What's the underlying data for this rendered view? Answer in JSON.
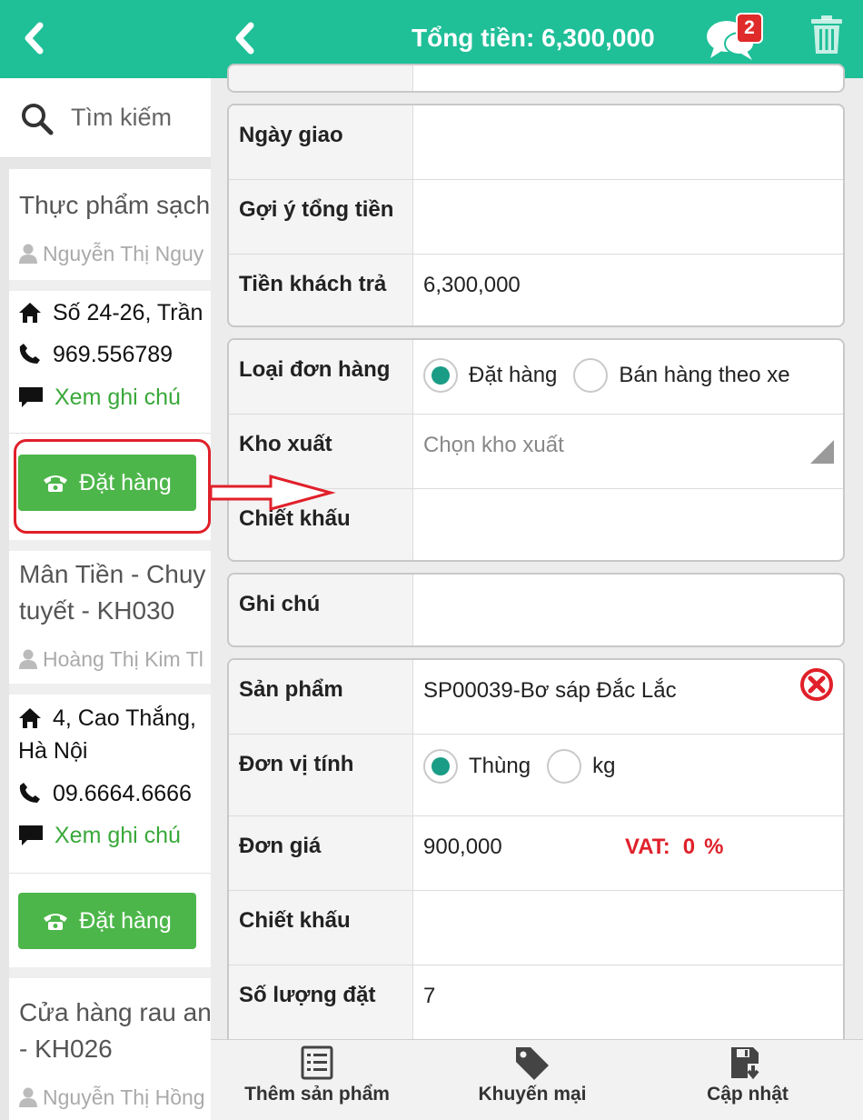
{
  "header": {
    "total_label": "Tổng tiền: 6,300,000",
    "chat_badge": "2"
  },
  "search": {
    "placeholder": "Tìm kiếm"
  },
  "customers": [
    {
      "name": "Thực phẩm sạch",
      "staff": "Nguyễn Thị Nguy",
      "address": "Số 24-26, Trần",
      "phone": "969.556789",
      "note_link": "Xem ghi chú",
      "order_button": "Đặt hàng"
    },
    {
      "name_line1": "Mân Tiền - Chuy",
      "name_line2": "tuyết - KH030",
      "staff": "Hoàng Thị Kim Tl",
      "address_line1": "4, Cao Thắng,",
      "address_line2": "Hà Nội",
      "phone": "09.6664.6666",
      "note_link": "Xem ghi chú",
      "order_button": "Đặt hàng"
    },
    {
      "name_line1": "Cửa hàng rau an",
      "name_line2": "- KH026",
      "staff": "Nguyễn Thị Hồng"
    }
  ],
  "order_form": {
    "delivery_date_label": "Ngày giao",
    "delivery_date_value": "",
    "suggested_total_label": "Gợi ý tổng tiền",
    "suggested_total_value": "",
    "customer_paid_label": "Tiền khách trả",
    "customer_paid_value": "6,300,000",
    "order_type_label": "Loại đơn hàng",
    "order_type_options": [
      "Đặt hàng",
      "Bán hàng theo xe"
    ],
    "order_type_selected": "Đặt hàng",
    "warehouse_label": "Kho xuất",
    "warehouse_placeholder": "Chọn kho xuất",
    "discount_label": "Chiết khấu",
    "discount_value": "",
    "note_label": "Ghi chú",
    "note_value": ""
  },
  "product": {
    "product_label": "Sản phẩm",
    "product_value": "SP00039-Bơ sáp Đắc Lắc",
    "unit_label": "Đơn vị tính",
    "unit_options": [
      "Thùng",
      "kg"
    ],
    "unit_selected": "Thùng",
    "price_label": "Đơn giá",
    "price_value": "900,000",
    "vat_label": "VAT:",
    "vat_value": "0",
    "vat_unit": "%",
    "discount_label": "Chiết khấu",
    "discount_value": "",
    "quantity_label": "Số lượng đặt",
    "quantity_value": "7"
  },
  "toolbar": {
    "add_product": "Thêm sản phẩm",
    "promotion": "Khuyến mại",
    "update": "Cập nhật"
  },
  "colors": {
    "header": "#1fbf98",
    "order_button": "#4db64a",
    "note_link": "#3aa83a",
    "vat": "#e0202a",
    "radio_selected": "#1a9c86",
    "annotation": "#e0202a"
  }
}
